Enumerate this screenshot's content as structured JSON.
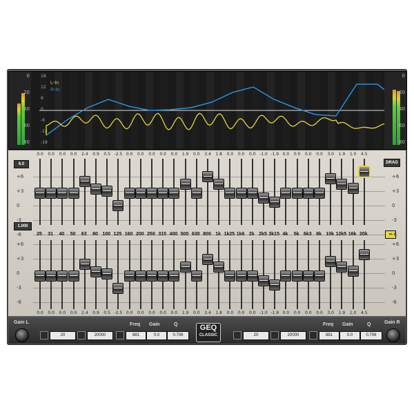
{
  "analyzer": {
    "left_scale": [
      "0",
      "20",
      "40",
      "60",
      "80"
    ],
    "right_scale": [
      "0",
      "20",
      "40",
      "60",
      "80"
    ],
    "graph_scale": [
      "18",
      "12",
      "6",
      "0",
      "-6",
      "-12",
      "-18"
    ],
    "legend": [
      {
        "label": "L-In",
        "color": "#e6d53a"
      },
      {
        "label": "R-In",
        "color": "#2b8fd8"
      }
    ]
  },
  "panel": {
    "left_scale": [
      "+6",
      "+3",
      "0",
      "-3",
      "-6"
    ],
    "right_scale": [
      "+6",
      "+3",
      "0",
      "-3",
      "-6"
    ],
    "top_button": "6.0",
    "mid_button": "1.000",
    "drag_button": "DRAG",
    "link_button": "∞"
  },
  "bands": {
    "freqs": [
      "25",
      "31",
      "40",
      "50",
      "63",
      "80",
      "100",
      "125",
      "160",
      "200",
      "250",
      "315",
      "400",
      "500",
      "630",
      "800",
      "1k",
      "1k25",
      "1k6",
      "2k",
      "2k5",
      "3k15",
      "4k",
      "5k",
      "6k3",
      "8k",
      "10k",
      "12k5",
      "16k",
      "20k"
    ],
    "top_values": [
      "0.0",
      "0.0",
      "0.0",
      "0.0",
      "2.4",
      "0.9",
      "0.5",
      "-2.5",
      "0.0",
      "0.0",
      "0.0",
      "0.0",
      "0.0",
      "1.9",
      "0.0",
      "3.4",
      "1.8",
      "0.0",
      "0.0",
      "0.0",
      "-1.0",
      "-1.9",
      "0.0",
      "0.0",
      "0.0",
      "0.0",
      "3.0",
      "1.9",
      "1.0",
      "4.5"
    ],
    "bottom_values": [
      "0.0",
      "0.0",
      "0.0",
      "0.0",
      "2.4",
      "0.9",
      "0.5",
      "-2.5",
      "0.0",
      "0.0",
      "0.0",
      "0.0",
      "0.0",
      "1.9",
      "0.0",
      "3.4",
      "1.8",
      "0.0",
      "0.0",
      "0.0",
      "-1.0",
      "-1.9",
      "0.0",
      "0.0",
      "0.0",
      "0.0",
      "3.0",
      "1.9",
      "1.0",
      "4.5"
    ]
  },
  "bottom": {
    "gain_l_label": "Gain L",
    "gain_r_label": "Gain R",
    "logo_top": "GEQ",
    "logo_bottom": "CLASSIC",
    "left": {
      "low_cut": "20",
      "high_cut": "20000",
      "freq_label": "Freq",
      "gain_label": "Gain",
      "q_label": "Q",
      "freq": "881",
      "gain": "0.0",
      "q": "0.706"
    },
    "right": {
      "low_cut": "20",
      "high_cut": "20000",
      "freq_label": "Freq",
      "gain_label": "Gain",
      "q_label": "Q",
      "freq": "881",
      "gain": "0.0",
      "q": "0.706"
    }
  },
  "colors": {
    "accent": "#e8d64a",
    "panel": "#d4d0c8",
    "analyzer_bg": "#1a1a1a"
  }
}
